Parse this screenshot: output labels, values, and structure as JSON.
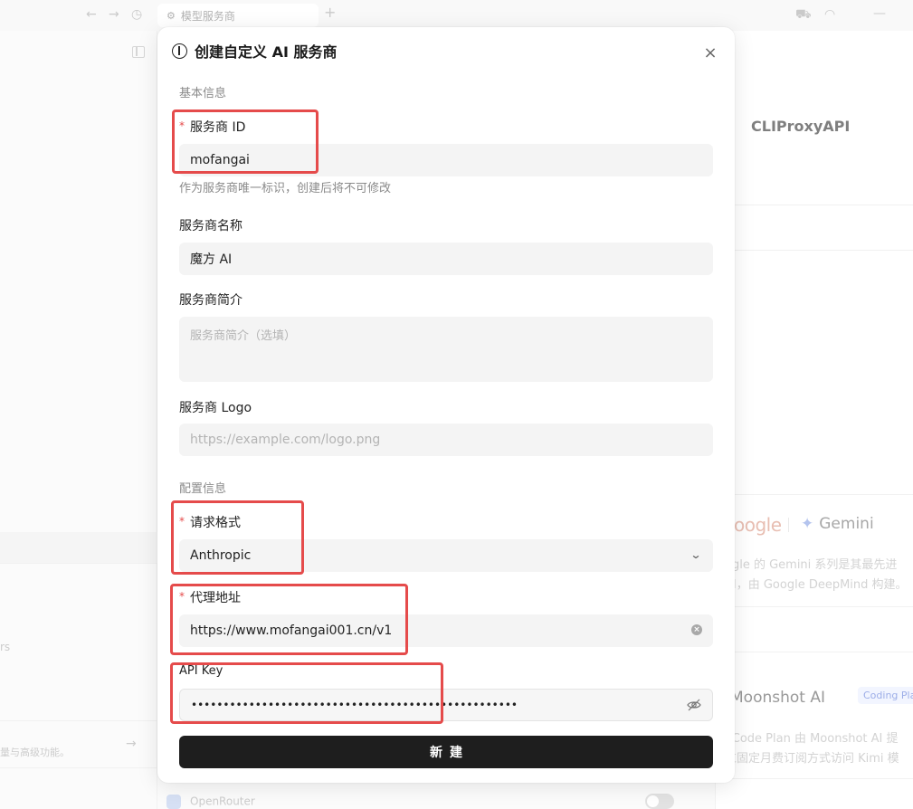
{
  "window": {
    "tab_title": "模型服务商",
    "tab_add": "+"
  },
  "background": {
    "right_title": "CLIProxyAPI",
    "google_logo": "oogle",
    "gemini_label": "Gemini",
    "gemini_desc_1": "ogle 的 Gemini 系列是其最先进",
    "gemini_desc_2": "AI，由 Google DeepMind 构建。",
    "moonshot_label": "Moonshot AI",
    "coding_badge": "Coding Pla",
    "moonshot_desc_1": "i Code Plan 由 Moonshot AI 提",
    "moonshot_desc_2": "过固定月费订阅方式访问 Kimi 模",
    "left_frag_rs": "rs",
    "left_frag_features": "量与高级功能。",
    "router_label": "OpenRouter"
  },
  "modal": {
    "title": "创建自定义 AI 服务商",
    "close": "×",
    "section_basic": "基本信息",
    "section_config": "配置信息",
    "provider_id": {
      "label": "服务商 ID",
      "value": "mofangai",
      "hint": "作为服务商唯一标识，创建后将不可修改"
    },
    "provider_name": {
      "label": "服务商名称",
      "value": "魔方 AI"
    },
    "provider_desc": {
      "label": "服务商简介",
      "placeholder": "服务商简介（选填）"
    },
    "provider_logo": {
      "label": "服务商 Logo",
      "placeholder": "https://example.com/logo.png"
    },
    "request_format": {
      "label": "请求格式",
      "value": "Anthropic"
    },
    "proxy_url": {
      "label": "代理地址",
      "value": "https://www.mofangai001.cn/v1"
    },
    "api_key": {
      "label": "API Key",
      "value": "•••••••••••••••••••••••••••••••••••••••••••••••••••"
    },
    "required_mark": "*",
    "submit_label": "新建"
  },
  "colors": {
    "highlight": "#e54b4b",
    "submit_bg": "#1e1e1e",
    "required": "#e54b4b"
  }
}
